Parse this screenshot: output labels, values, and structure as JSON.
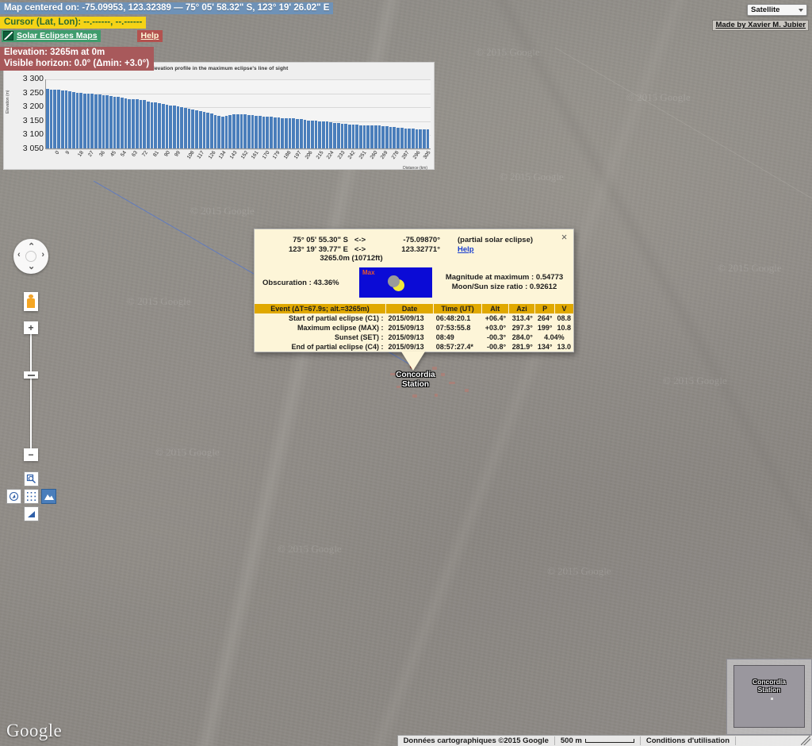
{
  "header": {
    "map_centered_label": "Map centered on: -75.09953, 123.32389 — 75° 05' 58.32\" S, 123° 19' 26.02\" E",
    "cursor_label": "Cursor (Lat, Lon): --.------, --.------",
    "site_link": "Solar Eclipses Maps",
    "help_label": "Help",
    "elevation_line1": "Elevation: 3265m at 0m",
    "elevation_line2": "Visible horizon: 0.0° (Δmin: +3.0°)",
    "map_type": "Satellite",
    "made_by": "Made by Xavier M. Jubier"
  },
  "chart_data": {
    "type": "bar",
    "title": "Elevation profile in the maximum eclipse's line of sight",
    "xlabel": "Distance (km)",
    "ylabel": "Elevation (m)",
    "ylim": [
      3050,
      3300
    ],
    "yticks": [
      "3 300",
      "3 250",
      "3 200",
      "3 150",
      "3 100",
      "3 050"
    ],
    "ytick_values": [
      3300,
      3250,
      3200,
      3150,
      3100,
      3050
    ],
    "categories": [
      0,
      3,
      6,
      9,
      12,
      15,
      18,
      21,
      24,
      27,
      30,
      33,
      36,
      39,
      42,
      45,
      48,
      51,
      54,
      57,
      60,
      63,
      66,
      69,
      72,
      75,
      78,
      81,
      84,
      87,
      90,
      93,
      96,
      99,
      102,
      105,
      108,
      111,
      114,
      117,
      120,
      123,
      126,
      129,
      132,
      134,
      137,
      140,
      143,
      146,
      149,
      152,
      155,
      158,
      161,
      164,
      167,
      170,
      173,
      176,
      179,
      182,
      185,
      188,
      191,
      194,
      197,
      200,
      203,
      206,
      209,
      212,
      215,
      218,
      221,
      224,
      227,
      230,
      233,
      236,
      239,
      242,
      245,
      248,
      251,
      254,
      257,
      260,
      263,
      266,
      269,
      272,
      275,
      278,
      281,
      284,
      287,
      290,
      293,
      296,
      299,
      302,
      305
    ],
    "xtick_labels": [
      "0",
      "9",
      "18",
      "27",
      "36",
      "45",
      "54",
      "63",
      "72",
      "81",
      "90",
      "99",
      "108",
      "117",
      "126",
      "134",
      "143",
      "152",
      "161",
      "170",
      "179",
      "188",
      "197",
      "206",
      "215",
      "224",
      "233",
      "242",
      "251",
      "260",
      "269",
      "278",
      "287",
      "296",
      "305"
    ],
    "values": [
      3265,
      3264,
      3263,
      3262,
      3261,
      3259,
      3258,
      3254,
      3252,
      3250,
      3249,
      3248,
      3248,
      3246,
      3245,
      3244,
      3243,
      3241,
      3238,
      3236,
      3234,
      3231,
      3229,
      3228,
      3227,
      3226,
      3224,
      3220,
      3218,
      3216,
      3213,
      3210,
      3207,
      3205,
      3204,
      3202,
      3200,
      3198,
      3195,
      3192,
      3188,
      3186,
      3183,
      3180,
      3177,
      3172,
      3168,
      3166,
      3167,
      3170,
      3173,
      3175,
      3174,
      3173,
      3172,
      3171,
      3169,
      3168,
      3166,
      3165,
      3164,
      3163,
      3161,
      3160,
      3159,
      3158,
      3159,
      3157,
      3155,
      3153,
      3152,
      3151,
      3150,
      3149,
      3148,
      3147,
      3145,
      3143,
      3141,
      3139,
      3138,
      3137,
      3136,
      3135,
      3134,
      3134,
      3133,
      3133,
      3132,
      3132,
      3131,
      3130,
      3128,
      3127,
      3125,
      3124,
      3123,
      3122,
      3121,
      3120,
      3120,
      3119,
      3118
    ],
    "grid": true,
    "bar_color": "#4a7ebb"
  },
  "popup": {
    "lat_dms": "75° 05' 55.30\" S",
    "lon_dms": "123° 19' 39.77\" E",
    "arrow": "<->",
    "lat_dec": "-75.09870°",
    "lon_dec": "123.32771°",
    "altitude": "3265.0m (10712ft)",
    "eclipse_type": "(partial solar eclipse)",
    "help_label": "Help",
    "obscuration": "Obscuration : 43.36%",
    "graphic_label": "Max",
    "magnitude": "Magnitude at maximum : 0.54773",
    "size_ratio": "Moon/Sun size ratio : 0.92612",
    "close_icon": "×",
    "table": {
      "headers": [
        "Event (ΔT=67.9s; alt.=3265m)",
        "Date",
        "Time (UT)",
        "Alt",
        "Azi",
        "P",
        "V"
      ],
      "rows": [
        {
          "event": "Start of partial eclipse (C1) :",
          "date": "2015/09/13",
          "time": "06:48:20.1",
          "alt": "+06.4°",
          "azi": "313.4°",
          "p": "264°",
          "v": "08.8"
        },
        {
          "event": "Maximum eclipse (MAX) :",
          "date": "2015/09/13",
          "time": "07:53:55.8",
          "alt": "+03.0°",
          "azi": "297.3°",
          "p": "199°",
          "v": "10.8"
        },
        {
          "event": "Sunset (SET) :",
          "date": "2015/09/13",
          "time": "08:49",
          "alt": "-00.3°",
          "azi": "284.0°",
          "p": "4.04%",
          "v": ""
        },
        {
          "event": "End of partial eclipse (C4) :",
          "date": "2015/09/13",
          "time": "08:57:27.4*",
          "alt": "-00.8°",
          "azi": "281.9°",
          "p": "134°",
          "v": "13.0"
        }
      ]
    }
  },
  "marker": {
    "label_line1": "Concordia",
    "label_line2": "Station"
  },
  "minimap": {
    "label_line1": "Concordia",
    "label_line2": "Station"
  },
  "footer": {
    "logo": "Google",
    "attribution": "Données cartographiques ©2015 Google",
    "scale": "500 m",
    "terms": "Conditions d'utilisation"
  },
  "watermarks": [
    "© 2015 Google",
    "© 2015 Google",
    "© 2015 Google",
    "© 2015 Google",
    "© 2015 Google",
    "© 2015 Google",
    "© 2015 Google",
    "© 2015 Google",
    "© 2015 Google",
    "© 2015 Google"
  ],
  "controls": {
    "zoom_in": "+",
    "zoom_out": "−",
    "pan_up": "⌃",
    "pan_down": "⌄",
    "pan_left": "‹",
    "pan_right": "›"
  }
}
